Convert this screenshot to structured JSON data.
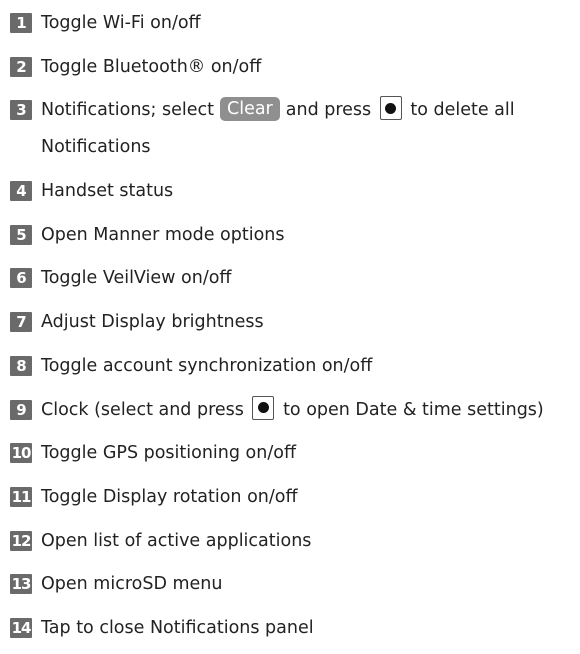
{
  "items": [
    {
      "num": "1",
      "text": "Toggle Wi-Fi on/off"
    },
    {
      "num": "2",
      "text": "Toggle Bluetooth® on/off"
    },
    {
      "num": "3",
      "text_a": "Notifications; select",
      "clear_label": "Clear",
      "text_b": "and press",
      "text_c": "to delete all",
      "text_d": "Notifications"
    },
    {
      "num": "4",
      "text": "Handset status"
    },
    {
      "num": "5",
      "text": "Open Manner mode options"
    },
    {
      "num": "6",
      "text": "Toggle VeilView on/off"
    },
    {
      "num": "7",
      "text": "Adjust Display brightness"
    },
    {
      "num": "8",
      "text": "Toggle account synchronization on/off"
    },
    {
      "num": "9",
      "text_a": "Clock (select and press",
      "text_b": "to open Date & time settings)"
    },
    {
      "num": "10",
      "text": "Toggle GPS positioning on/off"
    },
    {
      "num": "11",
      "text": "Toggle Display rotation on/off"
    },
    {
      "num": "12",
      "text": "Open list of active applications"
    },
    {
      "num": "13",
      "text": "Open microSD menu"
    },
    {
      "num": "14",
      "text": "Tap to close Notifications panel"
    }
  ],
  "icons": {
    "center_key": "center-key-icon"
  }
}
